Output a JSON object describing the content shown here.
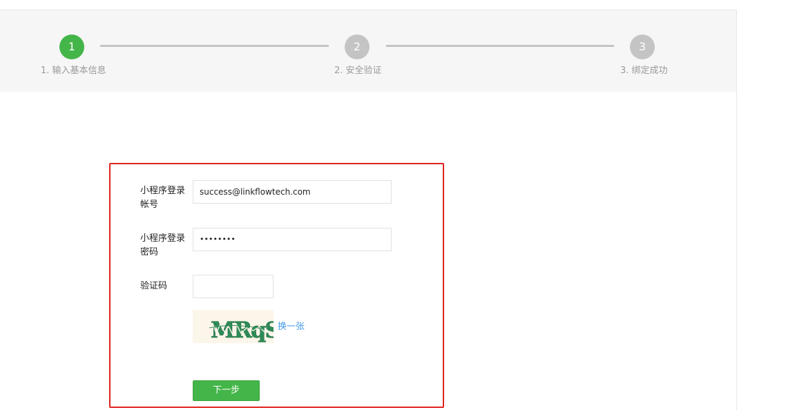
{
  "steps": [
    {
      "number": "1",
      "label": "1. 输入基本信息",
      "state": "active"
    },
    {
      "number": "2",
      "label": "2. 安全验证",
      "state": "todo"
    },
    {
      "number": "3",
      "label": "3. 绑定成功",
      "state": "todo"
    }
  ],
  "form": {
    "account_label": "小程序登录帐号",
    "account_value": "success@linkflowtech.com",
    "password_label": "小程序登录密码",
    "password_value": "••••••••",
    "captcha_label": "验证码",
    "captcha_value": "",
    "captcha_image_text": "MRqS",
    "refresh_label": "换一张",
    "next_label": "下一步"
  },
  "colors": {
    "accent_green": "#44b549",
    "step_inactive": "#c4c4c4",
    "highlight_border": "#e0231c",
    "link_blue": "#459ae9"
  }
}
